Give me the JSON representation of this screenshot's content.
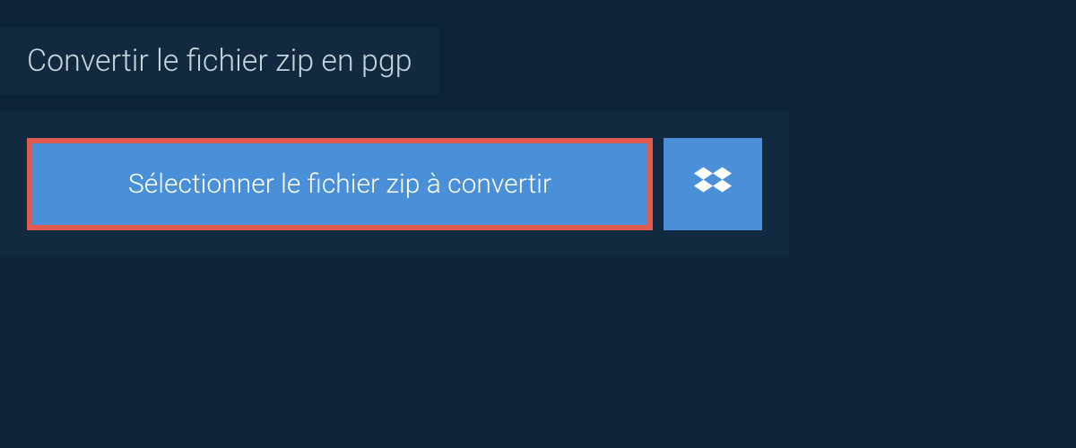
{
  "header": {
    "title": "Convertir le fichier zip en pgp"
  },
  "upload": {
    "select_button_label": "Sélectionner le fichier zip à convertir",
    "dropbox_icon": "dropbox-icon"
  },
  "colors": {
    "background": "#0d2438",
    "panel": "#122a3f",
    "button": "#4a90d9",
    "highlight_border": "#e05a4f",
    "text_light": "#c8d4de",
    "text_white": "#ffffff"
  }
}
